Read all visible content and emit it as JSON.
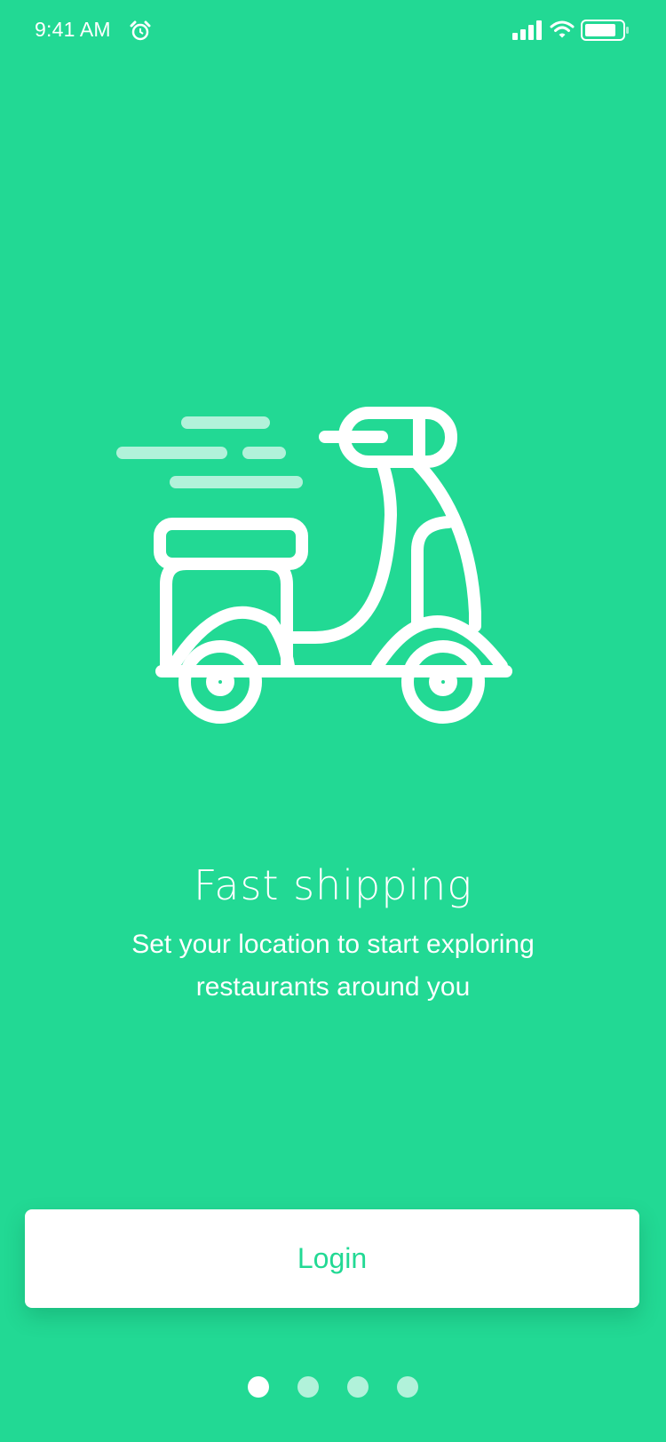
{
  "status_bar": {
    "time": "9:41 AM",
    "icons": [
      "alarm-icon",
      "signal-icon",
      "wifi-icon",
      "battery-icon"
    ],
    "battery_level": 0.85
  },
  "onboarding": {
    "illustration": "scooter-icon",
    "title": "Fast shipping",
    "subtitle": "Set your location to start exploring restaurants around you"
  },
  "login_button": {
    "label": "Login"
  },
  "pager": {
    "total": 4,
    "active_index": 0
  },
  "colors": {
    "background": "#22d994",
    "button_bg": "#ffffff",
    "button_text": "#22d994",
    "dot_inactive": "rgba(255,255,255,0.65)"
  }
}
